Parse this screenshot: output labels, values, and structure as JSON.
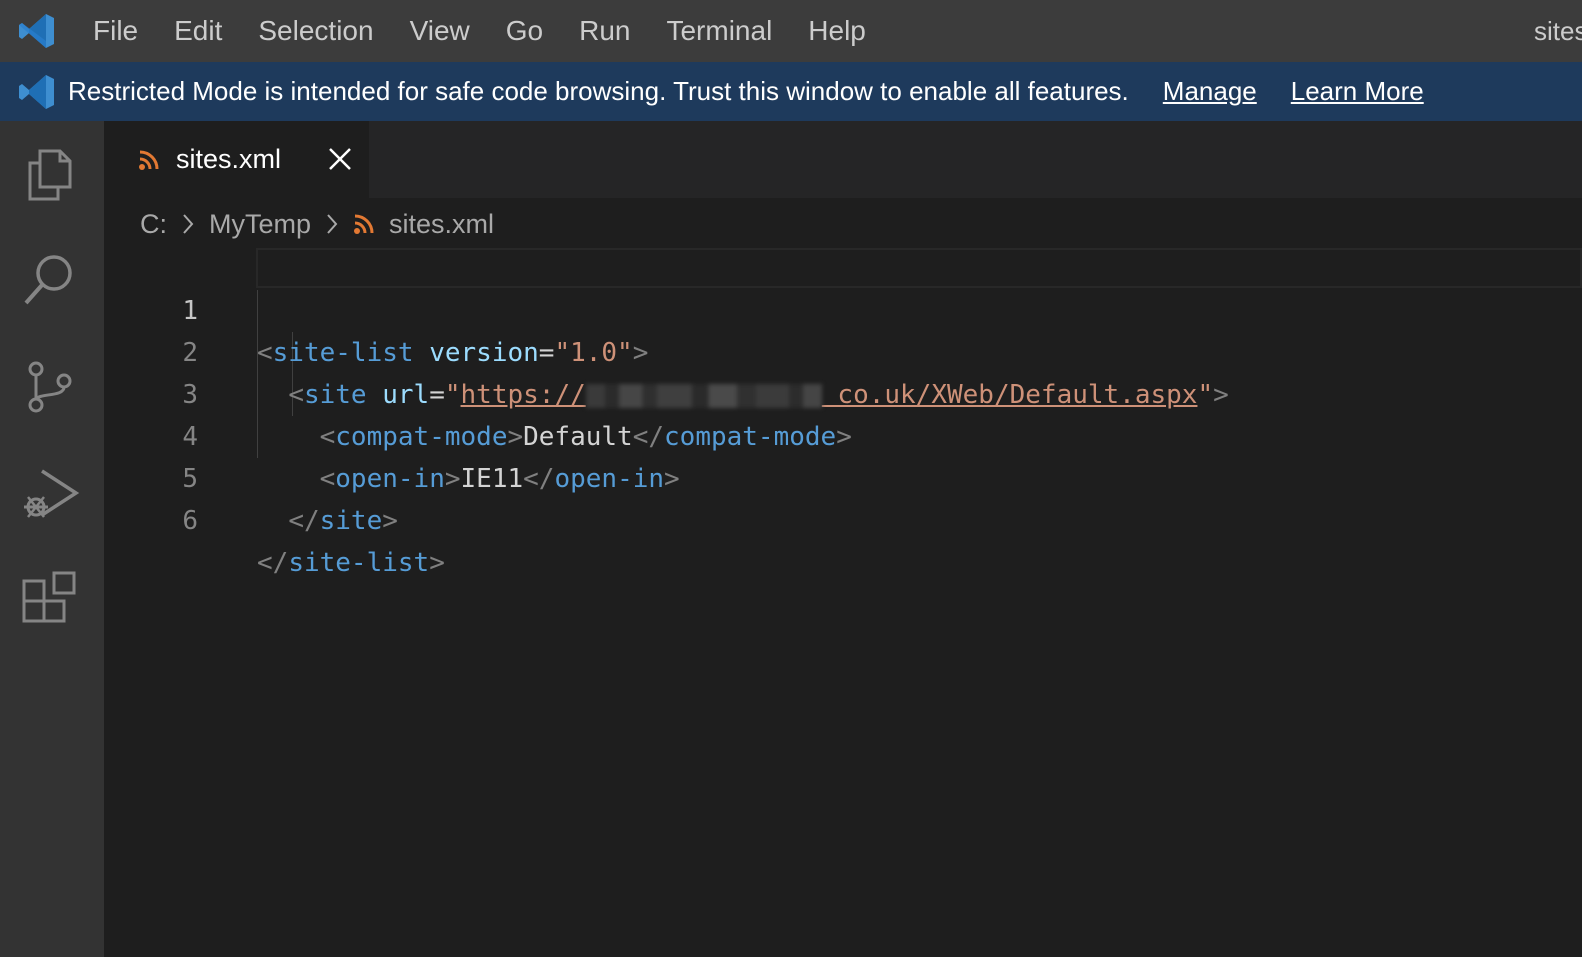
{
  "menubar": {
    "items": [
      "File",
      "Edit",
      "Selection",
      "View",
      "Go",
      "Run",
      "Terminal",
      "Help"
    ],
    "window_title": "sites.xml"
  },
  "banner": {
    "message": "Restricted Mode is intended for safe code browsing. Trust this window to enable all features.",
    "manage_label": "Manage",
    "learn_more_label": "Learn More"
  },
  "activitybar": {
    "icons": [
      "files-icon",
      "search-icon",
      "source-control-icon",
      "run-debug-icon",
      "extensions-icon"
    ]
  },
  "tab": {
    "label": "sites.xml",
    "icon": "rss-icon"
  },
  "breadcrumb": {
    "drive": "C:",
    "folder": "MyTemp",
    "file": "sites.xml"
  },
  "editor": {
    "lines": [
      {
        "number": "1"
      },
      {
        "number": "2"
      },
      {
        "number": "3"
      },
      {
        "number": "4"
      },
      {
        "number": "5"
      },
      {
        "number": "6"
      }
    ],
    "code": {
      "l1_tag": "site-list",
      "l1_attr": "version",
      "l1_value": "\"1.0\"",
      "l2_tag": "site",
      "l2_attr": "url",
      "l2_value_start": "https://",
      "l2_value_end": " co.uk/XWeb/Default.aspx",
      "l3_tag": "compat-mode",
      "l3_text": "Default",
      "l4_tag": "open-in",
      "l4_text": "IE11",
      "l5_tag": "site",
      "l6_tag": "site-list"
    }
  },
  "colors": {
    "tag": "#569cd6",
    "attribute": "#9cdcfe",
    "string": "#ce9178",
    "punctuation": "#808080",
    "banner_bg": "#1e3a5c"
  }
}
